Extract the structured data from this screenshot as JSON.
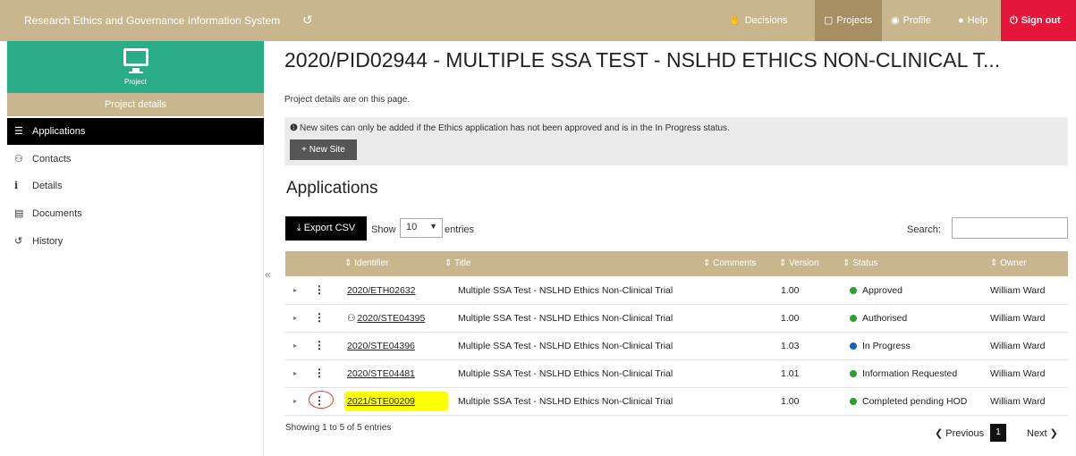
{
  "header": {
    "app_title": "Research Ethics and Governance Information System",
    "history_icon": "↺",
    "nav": [
      {
        "icon": "✋",
        "label": "Decisions"
      },
      {
        "icon": "▢",
        "label": "Projects"
      },
      {
        "icon": "◉",
        "label": "Profile"
      },
      {
        "icon": "●",
        "label": "Help"
      },
      {
        "icon": "⏻",
        "label": "Sign out"
      }
    ]
  },
  "sidebar": {
    "project_label": "Project",
    "project_details": "Project details",
    "items": [
      {
        "icon": "☰",
        "label": "Applications"
      },
      {
        "icon": "⚇",
        "label": "Contacts"
      },
      {
        "icon": "i",
        "label": "Details"
      },
      {
        "icon": "▤",
        "label": "Documents"
      },
      {
        "icon": "↺",
        "label": "History"
      }
    ],
    "collapse_glyph": "«"
  },
  "main": {
    "title": "2020/PID02944 - MULTIPLE SSA TEST - NSLHD ETHICS NON-CLINICAL T...",
    "subtitle": "Project details are on this page.",
    "notice_icon": "❶",
    "notice": "New sites can only be added if the Ethics application has not been approved and is in the In Progress status.",
    "new_site_button": "+ New Site",
    "applications_heading": "Applications",
    "export_button": "⤓  Export CSV",
    "show_label": "Show",
    "entries_value": "10",
    "entries_label": "entries",
    "search_label": "Search:",
    "search_value": ""
  },
  "table": {
    "columns": [
      "⇕ Identifier",
      "⇕ Title",
      "⇕ Comments",
      "⇕ Version",
      "⇕ Status",
      "⇕ Owner"
    ],
    "rows": [
      {
        "identifier": "2020/ETH02632",
        "title": "Multiple SSA Test - NSLHD Ethics Non-Clinical Trial",
        "version": "1.00",
        "status": "Approved",
        "status_color": "#2e9e2e",
        "owner": "William Ward",
        "icon": ""
      },
      {
        "identifier": "2020/STE04395",
        "title": "Multiple SSA Test - NSLHD Ethics Non-Clinical Trial",
        "version": "1.00",
        "status": "Authorised",
        "status_color": "#2e9e2e",
        "owner": "William Ward",
        "icon": "⚇"
      },
      {
        "identifier": "2020/STE04396",
        "title": "Multiple SSA Test - NSLHD Ethics Non-Clinical Trial",
        "version": "1.03",
        "status": "In Progress",
        "status_color": "#1565c0",
        "owner": "William Ward",
        "icon": ""
      },
      {
        "identifier": "2020/STE04481",
        "title": "Multiple SSA Test - NSLHD Ethics Non-Clinical Trial",
        "version": "1.01",
        "status": "Information Requested",
        "status_color": "#2e9e2e",
        "owner": "William Ward",
        "icon": ""
      },
      {
        "identifier": "2021/STE00209",
        "title": "Multiple SSA Test - NSLHD Ethics Non-Clinical Trial",
        "version": "1.00",
        "status": "Completed pending HOD",
        "status_color": "#2e9e2e",
        "owner": "William Ward",
        "icon": ""
      }
    ],
    "expander_glyph": "▸",
    "kebab_glyph": "⋮"
  },
  "footer": {
    "info": "Showing 1 to 5 of 5 entries",
    "previous": "❮ Previous",
    "page": "1",
    "next": "Next ❯"
  },
  "colors": {
    "header_bg": "#c9b68f",
    "accent_green": "#2bac88",
    "signout_red": "#e6153a",
    "highlight": "#ffff00"
  }
}
